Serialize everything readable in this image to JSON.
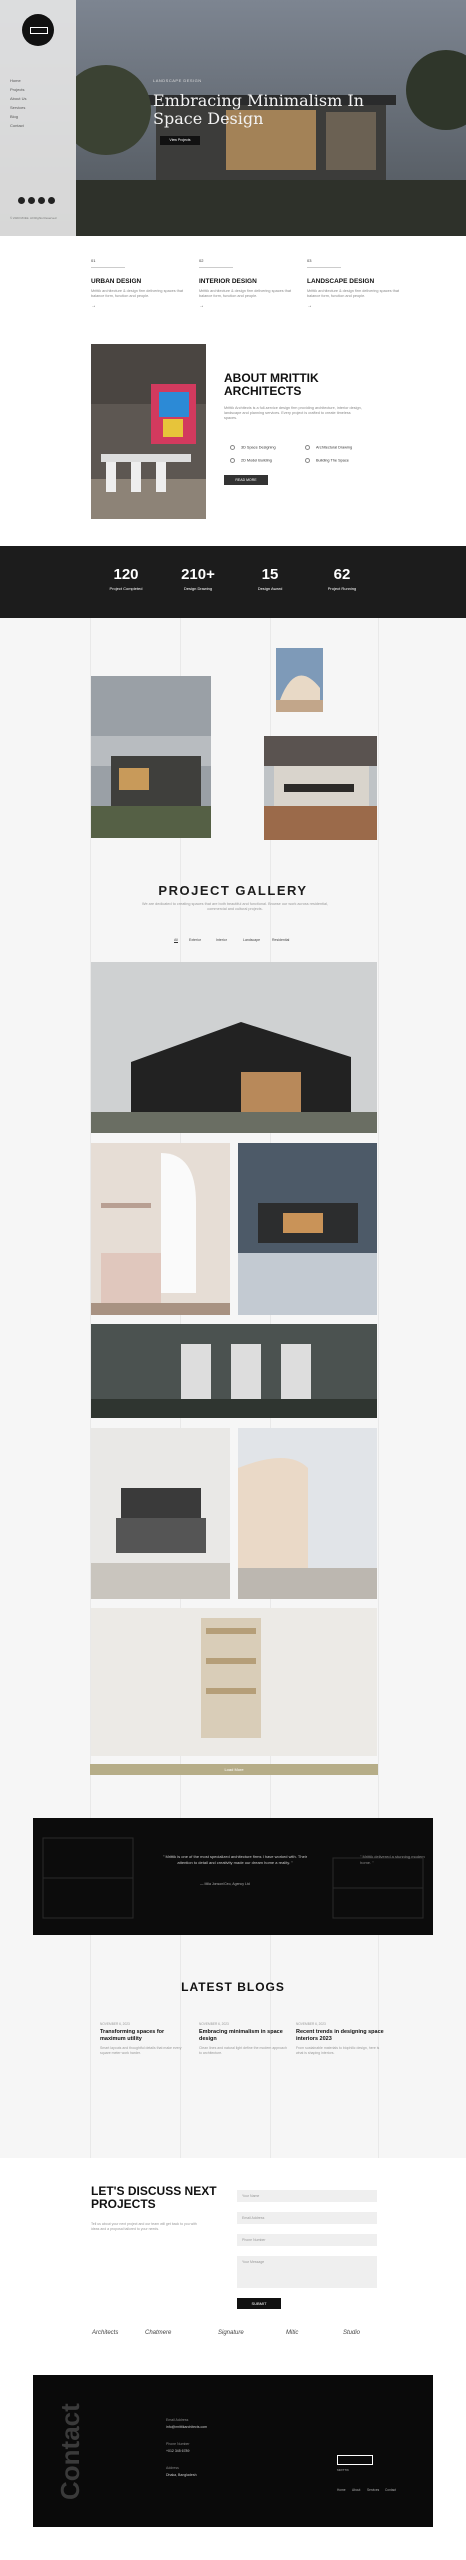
{
  "hero": {
    "eyebrow": "LANDSCAPE DESIGN",
    "title": "Embracing Minimalism In Space Design",
    "button": "View Projects",
    "nav": [
      "Home",
      "Projects",
      "About Us",
      "Services",
      "Blog",
      "Contact"
    ],
    "copyright": "© 2023 Mrittik. All Rights Reserved"
  },
  "services": [
    {
      "num": "01",
      "title": "URBAN DESIGN",
      "desc": "Mrittik architecture & design firm delivering spaces that balance form, function and people.",
      "arrow": "→"
    },
    {
      "num": "02",
      "title": "INTERIOR DESIGN",
      "desc": "Mrittik architecture & design firm delivering spaces that balance form, function and people.",
      "arrow": "→"
    },
    {
      "num": "03",
      "title": "LANDSCAPE DESIGN",
      "desc": "Mrittik architecture & design firm delivering spaces that balance form, function and people.",
      "arrow": "→"
    }
  ],
  "about": {
    "title": "ABOUT MRITTIK ARCHITECTS",
    "desc": "Mrittik Architects is a full-service design firm providing architecture, interior design, landscape and planning services. Every project is crafted to create timeless spaces.",
    "bullets": [
      "3D Space Designing",
      "Architectural Drawing",
      "2D Model Building",
      "Building The Space"
    ],
    "button": "READ MORE"
  },
  "stats": [
    {
      "num": "120",
      "label": "Project Completed"
    },
    {
      "num": "210+",
      "label": "Design Drawing"
    },
    {
      "num": "15",
      "label": "Design Award"
    },
    {
      "num": "62",
      "label": "Project Running"
    }
  ],
  "gallery": {
    "title": "PROJECT GALLERY",
    "desc": "We are dedicated to creating spaces that are both beautiful and functional. Browse our work across residential, commercial and cultural projects.",
    "filters": [
      "All",
      "Exterior",
      "Interior",
      "Landscape",
      "Residential"
    ],
    "more": "Load More"
  },
  "testimonial": {
    "quote": "\" Mrittik is one of the most specialized architecture firms I have worked with. Their attention to detail and creativity made our dream home a reality. \"",
    "quote2": "\" Mrittik delivered a stunning modern home. \"",
    "author": "—  Mila Jonson/Ceo, Agency Ltd"
  },
  "blogs": {
    "title": "LATEST BLOGS",
    "items": [
      {
        "date": "NOVEMBER 6, 2023",
        "title": "Transforming spaces for maximum utility",
        "desc": "Smart layouts and thoughtful details that make every square meter work harder."
      },
      {
        "date": "NOVEMBER 6, 2023",
        "title": "Embracing minimalism in space design",
        "desc": "Clean lines and natural light define the modern approach to architecture."
      },
      {
        "date": "NOVEMBER 6, 2023",
        "title": "Recent trends in designing space interiors 2023",
        "desc": "From sustainable materials to biophilic design, here is what is shaping interiors."
      }
    ]
  },
  "discuss": {
    "title": "LET'S DISCUSS NEXT PROJECTS",
    "desc": "Tell us about your next project and our team will get back to you with ideas and a proposal tailored to your needs.",
    "fields": [
      "Your Name",
      "Email Address",
      "Phone Number",
      "Your Message"
    ],
    "submit": "SUBMIT",
    "brands": [
      "Architects",
      "Chatmere",
      "Signature",
      "Mitic",
      "Studio"
    ]
  },
  "footer": {
    "contact": "Contact",
    "labels": [
      "Email Address",
      "Phone Number",
      "Address"
    ],
    "values": [
      "info@mrittikarchitects.com",
      "+012 345 6789",
      "Dhaka, Bangladesh"
    ],
    "links": [
      "Home",
      "About",
      "Services",
      "Contact"
    ],
    "logo_text": "MRITTIK"
  }
}
